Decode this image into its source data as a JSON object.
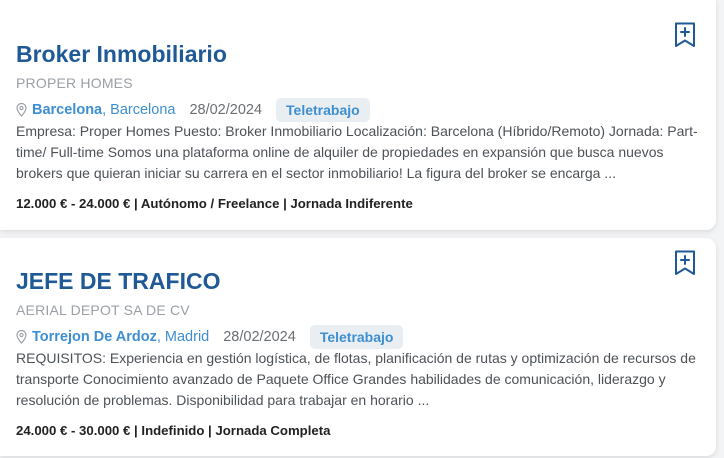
{
  "jobs": [
    {
      "title": "Broker Inmobiliario",
      "company": "PROPER HOMES",
      "city": "Barcelona",
      "province": "Barcelona",
      "date": "28/02/2024",
      "badge": "Teletrabajo",
      "description": "Empresa: Proper Homes Puesto: Broker Inmobiliario Localización: Barcelona (Híbrido/Remoto) Jornada: Part-time/ Full-time Somos una plataforma online de alquiler de propiedades en expansión que busca nuevos brokers que quieran iniciar su carrera en el sector inmobiliario! La figura del broker se encarga ...",
      "details": "12.000 € - 24.000 € | Autónomo / Freelance | Jornada Indiferente",
      "bookmark_icon": "bookmark-add-icon"
    },
    {
      "title": "JEFE DE TRAFICO",
      "company": "AERIAL DEPOT SA DE CV",
      "city": "Torrejon De Ardoz",
      "province": "Madrid",
      "date": "28/02/2024",
      "badge": "Teletrabajo",
      "description": "REQUISITOS: Experiencia en gestión logística, de flotas, planificación de rutas y optimización de recursos de transporte Conocimiento avanzado de Paquete Office Grandes habilidades de comunicación, liderazgo y resolución de problemas. Disponibilidad para trabajar en horario ...",
      "details": "24.000 € - 30.000 € | Indefinido | Jornada Completa",
      "bookmark_icon": "bookmark-add-icon"
    }
  ],
  "colors": {
    "title": "#1f5a96",
    "link": "#3d8fd1",
    "muted": "#9aa0a6",
    "badge_bg": "#e9eef3"
  }
}
